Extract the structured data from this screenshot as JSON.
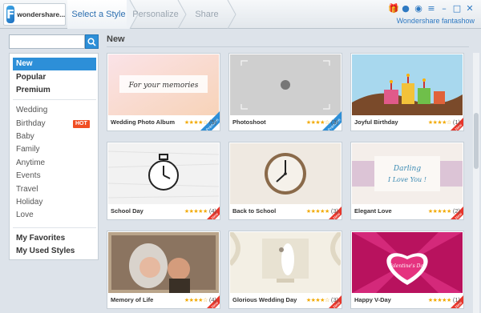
{
  "app": {
    "logo_text": "wondershare...",
    "brand": "Wondershare fantashow"
  },
  "steps": [
    "Select a Style",
    "Personalize",
    "Share"
  ],
  "search": {
    "placeholder": "",
    "value": ""
  },
  "sidebar": {
    "top_items": [
      "New",
      "Popular",
      "Premium"
    ],
    "categories": [
      "Wedding",
      "Birthday",
      "Baby",
      "Family",
      "Anytime",
      "Events",
      "Travel",
      "Holiday",
      "Love"
    ],
    "hot_badge": "HOT",
    "bottom_items": [
      "My Favorites",
      "My Used Styles"
    ]
  },
  "main": {
    "title": "New"
  },
  "styles": [
    {
      "name": "Wedding Photo Album",
      "rating_stars": 4,
      "reviews": "(5)",
      "thumb_text": "For your memories",
      "ribbon": "Premium"
    },
    {
      "name": "Photoshoot",
      "rating_stars": 4,
      "reviews": "(3)",
      "thumb_text": "",
      "ribbon": "Premium"
    },
    {
      "name": "Joyful Birthday",
      "rating_stars": 4,
      "reviews": "(1)",
      "thumb_text": "",
      "ribbon": "New"
    },
    {
      "name": "School Day",
      "rating_stars": 5,
      "reviews": "(4)",
      "thumb_text": "",
      "ribbon": "New"
    },
    {
      "name": "Back to School",
      "rating_stars": 5,
      "reviews": "(3)",
      "thumb_text": "",
      "ribbon": "New"
    },
    {
      "name": "Elegant Love",
      "rating_stars": 5,
      "reviews": "(2)",
      "thumb_text": "Darling I Love You !",
      "ribbon": "New"
    },
    {
      "name": "Memory of Life",
      "rating_stars": 4,
      "reviews": "(4)",
      "thumb_text": "",
      "ribbon": "New"
    },
    {
      "name": "Glorious Wedding Day",
      "rating_stars": 4,
      "reviews": "(3)",
      "thumb_text": "",
      "ribbon": "New"
    },
    {
      "name": "Happy V-Day",
      "rating_stars": 5,
      "reviews": "(1)",
      "thumb_text": "Valentine's Day",
      "ribbon": "New"
    }
  ],
  "colors": {
    "accent": "#2d8fd8",
    "star": "#f2a900",
    "hot": "#f04e23",
    "ribbon_new": "#e8352a",
    "ribbon_premium": "#2d8fd8"
  }
}
